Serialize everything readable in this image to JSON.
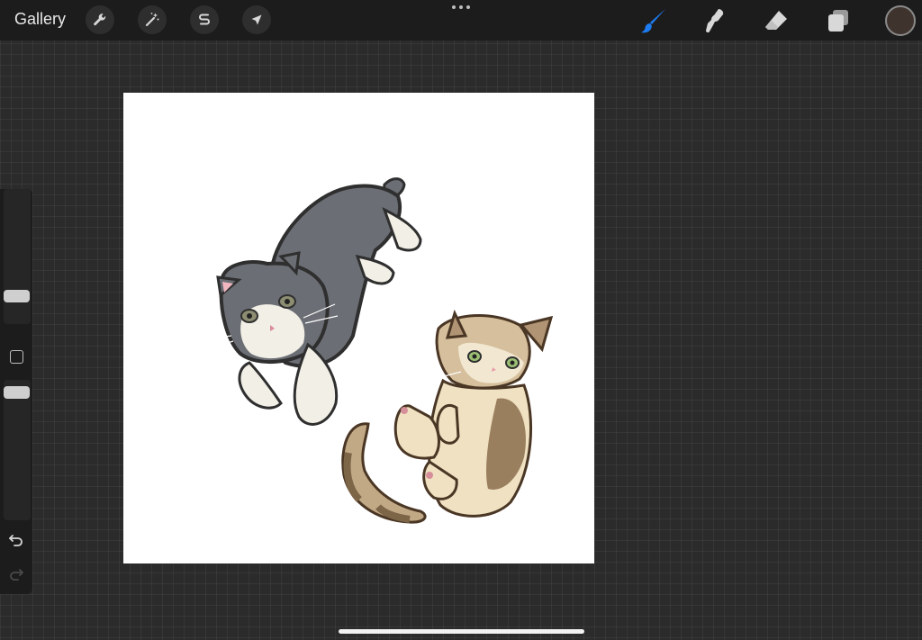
{
  "topbar": {
    "gallery_label": "Gallery",
    "left_tools": [
      {
        "name": "actions",
        "icon": "wrench-icon"
      },
      {
        "name": "adjustments",
        "icon": "magic-wand-icon"
      },
      {
        "name": "selection",
        "icon": "selection-s-icon"
      },
      {
        "name": "transform",
        "icon": "arrow-cursor-icon"
      }
    ],
    "right_tools": [
      {
        "name": "brush",
        "icon": "brush-icon",
        "active": true
      },
      {
        "name": "smudge",
        "icon": "smudge-icon",
        "active": false
      },
      {
        "name": "eraser",
        "icon": "eraser-icon",
        "active": false
      },
      {
        "name": "layers",
        "icon": "layers-icon",
        "active": false
      }
    ],
    "active_color": "#3f332d",
    "accent_color": "#1e7cf2"
  },
  "sidebar": {
    "brush_size_level": 0.18,
    "opacity_level": 0.95,
    "icons": [
      "modify-square-icon",
      "undo-icon",
      "redo-icon"
    ]
  },
  "canvas": {
    "background": "#ffffff",
    "content": [
      "gray-white-cat-illustration",
      "tabby-cat-illustration"
    ]
  }
}
